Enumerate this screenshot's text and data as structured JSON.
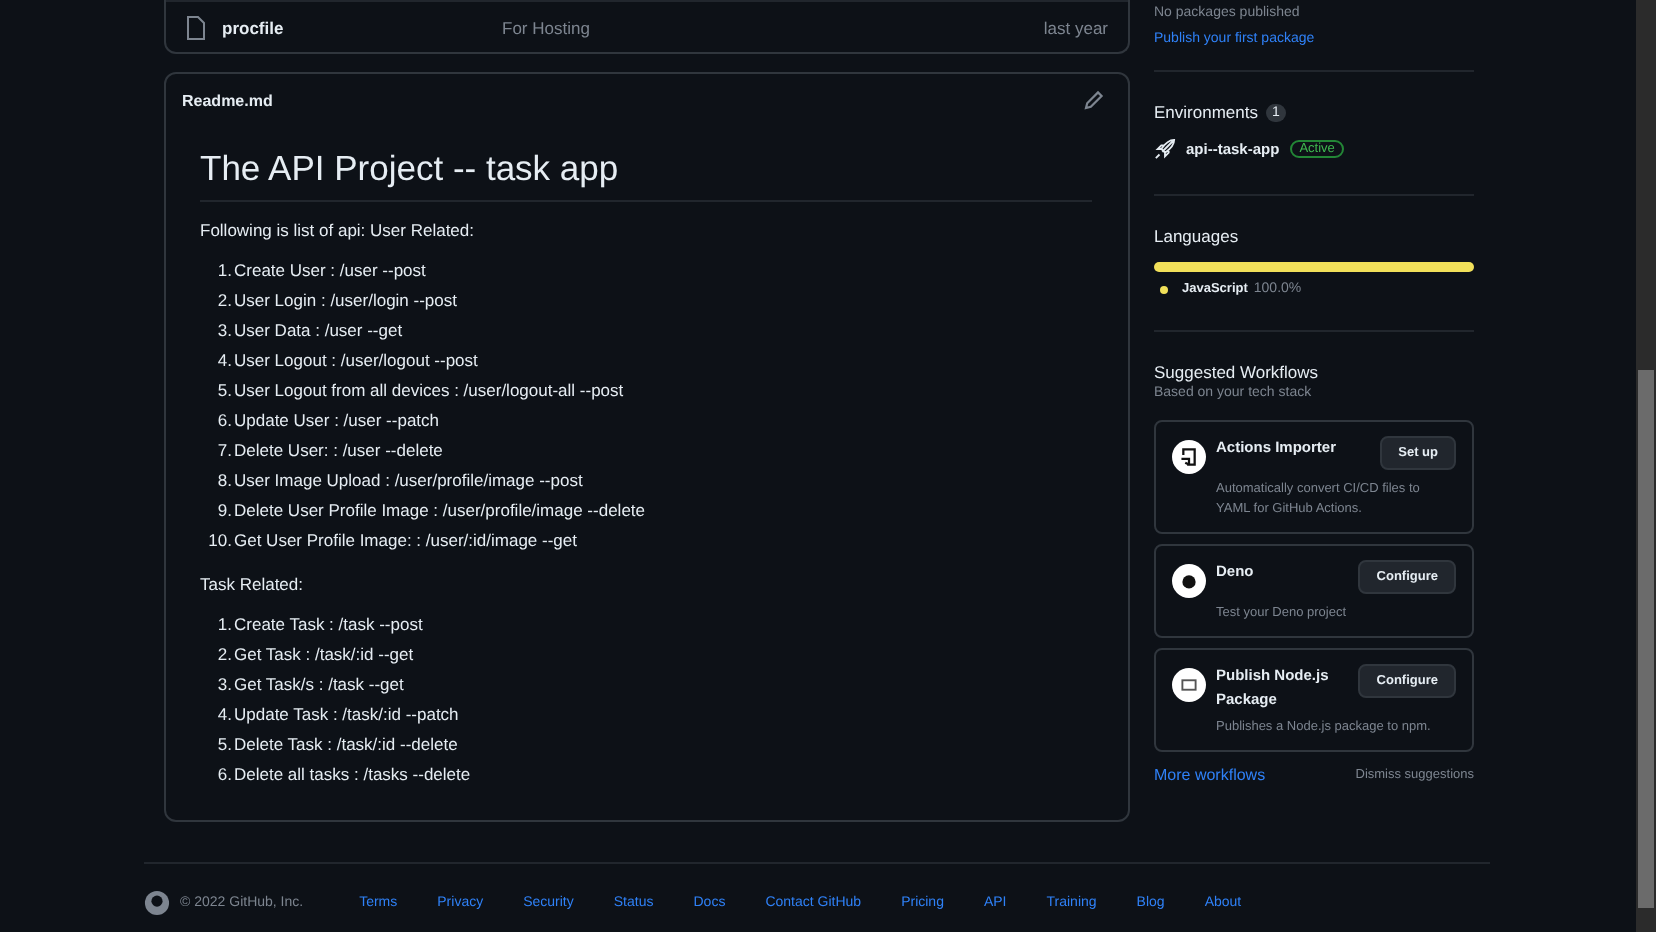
{
  "files": [
    {
      "name": "procfile",
      "message": "For Hosting",
      "time": "last year"
    }
  ],
  "readme": {
    "filename": "Readme.md",
    "title": "The API Project -- task app",
    "sections": [
      {
        "intro": "Following is list of api: User Related:",
        "items": [
          {
            "number": "1.",
            "text": "Create User : /user --post"
          },
          {
            "number": "2.",
            "text": "User Login : /user/login --post"
          },
          {
            "number": "3.",
            "text": "User Data : /user --get"
          },
          {
            "number": "4.",
            "text": "User Logout : /user/logout --post"
          },
          {
            "number": "5.",
            "text": "User Logout from all devices : /user/logout-all --post"
          },
          {
            "number": "6.",
            "text": "Update User : /user --patch"
          },
          {
            "number": "7.",
            "text": "Delete User: : /user --delete"
          },
          {
            "number": "8.",
            "text": "User Image Upload : /user/profile/image --post"
          },
          {
            "number": "9.",
            "text": "Delete User Profile Image : /user/profile/image --delete"
          },
          {
            "number": "10.",
            "text": "Get User Profile Image: : /user/:id/image --get"
          }
        ]
      },
      {
        "intro": "Task Related:",
        "items": [
          {
            "number": "1.",
            "text": "Create Task : /task --post"
          },
          {
            "number": "2.",
            "text": "Get Task : /task/:id --get"
          },
          {
            "number": "3.",
            "text": "Get Task/s : /task --get"
          },
          {
            "number": "4.",
            "text": "Update Task : /task/:id --patch"
          },
          {
            "number": "5.",
            "text": "Delete Task : /task/:id --delete"
          },
          {
            "number": "6.",
            "text": "Delete all tasks : /tasks --delete"
          }
        ]
      }
    ]
  },
  "packages": {
    "note": "No packages published",
    "link": "Publish your first package"
  },
  "environments": {
    "title": "Environments",
    "count": "1",
    "items": [
      {
        "name": "api--task-app",
        "status": "Active"
      }
    ]
  },
  "languages": {
    "title": "Languages",
    "items": [
      {
        "name": "JavaScript",
        "percent": "100.0%",
        "level": 1.0,
        "color": "#f1e05a"
      }
    ]
  },
  "workflows": {
    "title": "Suggested Workflows",
    "subtitle": "Based on your tech stack",
    "items": [
      {
        "kind": "importer",
        "name": "Actions Importer",
        "description": "Automatically convert CI/CD files to YAML for GitHub Actions.",
        "button": "Set up"
      },
      {
        "kind": "deno",
        "name": "Deno",
        "description": "Test your Deno project",
        "button": "Configure"
      },
      {
        "kind": "package",
        "name": "Publish Node.js Package",
        "description": "Publishes a Node.js package to npm.",
        "button": "Configure"
      }
    ],
    "more": "More workflows",
    "dismiss": "Dismiss suggestions"
  },
  "footer": {
    "copyright": "© 2022 GitHub, Inc.",
    "links": [
      "Terms",
      "Privacy",
      "Security",
      "Status",
      "Docs",
      "Contact GitHub",
      "Pricing",
      "API",
      "Training",
      "Blog",
      "About"
    ]
  }
}
